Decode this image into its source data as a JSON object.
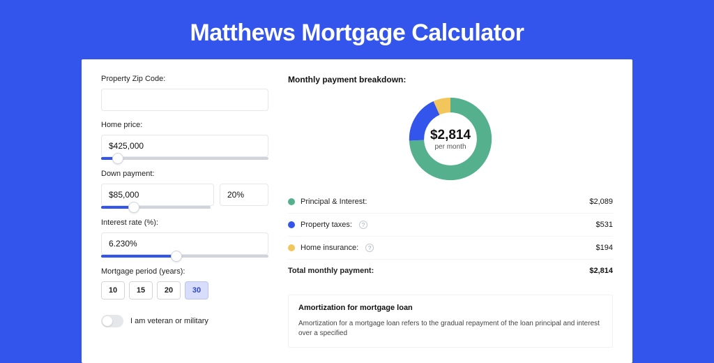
{
  "title": "Matthews Mortgage Calculator",
  "form": {
    "zip_label": "Property Zip Code:",
    "zip_value": "",
    "home_price_label": "Home price:",
    "home_price_value": "$425,000",
    "home_price_slider_pct": 10,
    "down_payment_label": "Down payment:",
    "down_payment_amount": "$85,000",
    "down_payment_pct": "20%",
    "down_payment_slider_pct": 30,
    "interest_label": "Interest rate (%):",
    "interest_value": "6.230%",
    "interest_slider_pct": 45,
    "period_label": "Mortgage period (years):",
    "period_options": [
      "10",
      "15",
      "20",
      "30"
    ],
    "period_selected": "30",
    "veteran_label": "I am veteran or military"
  },
  "breakdown": {
    "heading": "Monthly payment breakdown:",
    "center_amount": "$2,814",
    "center_sub": "per month",
    "items": [
      {
        "label": "Principal & Interest:",
        "value": "$2,089",
        "color": "#54b08d",
        "pct": 74.2,
        "info": false
      },
      {
        "label": "Property taxes:",
        "value": "$531",
        "color": "#3455eb",
        "pct": 18.9,
        "info": true
      },
      {
        "label": "Home insurance:",
        "value": "$194",
        "color": "#f3c65b",
        "pct": 6.9,
        "info": true
      }
    ],
    "total_label": "Total monthly payment:",
    "total_value": "$2,814"
  },
  "chart_data": {
    "type": "pie",
    "title": "Monthly payment breakdown",
    "categories": [
      "Principal & Interest",
      "Property taxes",
      "Home insurance"
    ],
    "values": [
      2089,
      531,
      194
    ],
    "colors": [
      "#54b08d",
      "#3455eb",
      "#f3c65b"
    ],
    "total": 2814,
    "unit": "USD/month",
    "donut": true
  },
  "amortization": {
    "heading": "Amortization for mortgage loan",
    "text": "Amortization for a mortgage loan refers to the gradual repayment of the loan principal and interest over a specified"
  }
}
